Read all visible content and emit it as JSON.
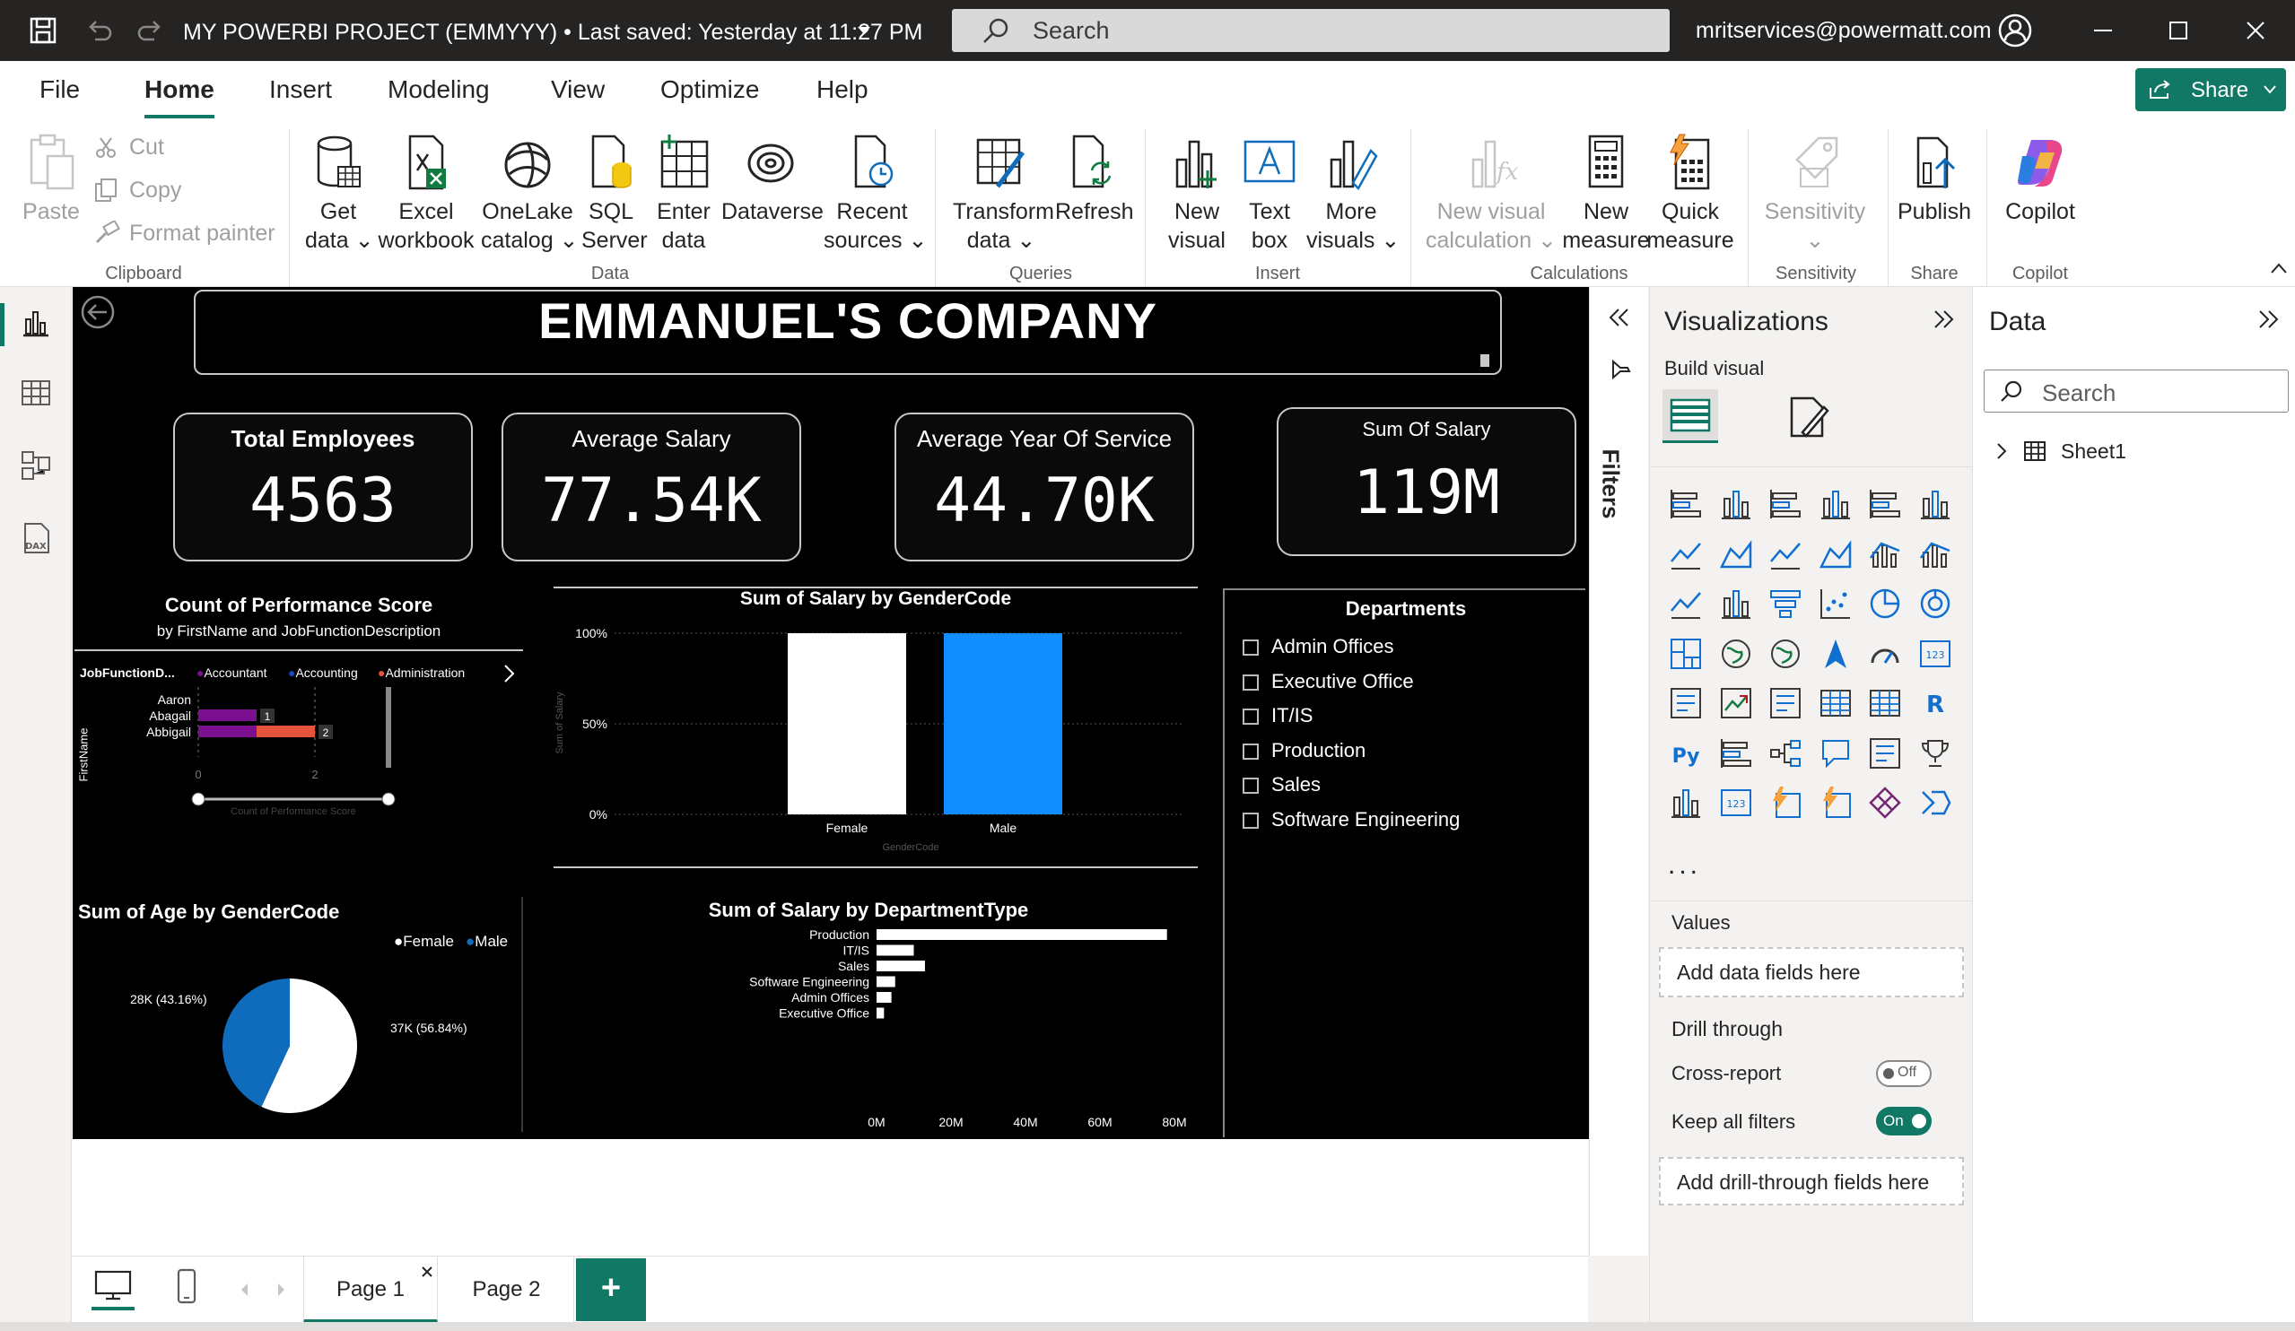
{
  "titlebar": {
    "document_title": "MY POWERBI PROJECT (EMMYYY) • Last saved: Yesterday at 11:27 PM",
    "search_placeholder": "Search",
    "account": "mritservices@powermatt.com"
  },
  "menu": {
    "items": [
      "File",
      "Home",
      "Insert",
      "Modeling",
      "View",
      "Optimize",
      "Help"
    ],
    "active": "Home",
    "share_label": "Share"
  },
  "ribbon": {
    "clipboard": {
      "paste": "Paste",
      "cut": "Cut",
      "copy": "Copy",
      "format_painter": "Format painter",
      "group": "Clipboard"
    },
    "data": {
      "get_data": [
        "Get",
        "data ⌄"
      ],
      "excel": [
        "Excel",
        "workbook"
      ],
      "onelake": [
        "OneLake",
        "catalog ⌄"
      ],
      "sql": [
        "SQL",
        "Server"
      ],
      "enter": [
        "Enter",
        "data"
      ],
      "dataverse": [
        "Dataverse",
        ""
      ],
      "recent": [
        "Recent",
        "sources ⌄"
      ],
      "group": "Data"
    },
    "queries": {
      "transform": [
        "Transform",
        "data ⌄"
      ],
      "refresh": [
        "Refresh",
        ""
      ],
      "group": "Queries"
    },
    "insert": {
      "new_visual": [
        "New",
        "visual"
      ],
      "text_box": [
        "Text",
        "box"
      ],
      "more_visuals": [
        "More",
        "visuals ⌄"
      ],
      "group": "Insert"
    },
    "calculations": {
      "new_visual_calc": [
        "New visual",
        "calculation ⌄"
      ],
      "new_measure": [
        "New",
        "measure"
      ],
      "quick_measure": [
        "Quick",
        "measure"
      ],
      "group": "Calculations"
    },
    "sensitivity": {
      "label": [
        "Sensitivity",
        "⌄"
      ],
      "group": "Sensitivity"
    },
    "share": {
      "publish": [
        "Publish",
        ""
      ],
      "group": "Share"
    },
    "copilot": {
      "label": [
        "Copilot",
        ""
      ],
      "group": "Copilot"
    }
  },
  "report": {
    "title": "EMMANUEL'S COMPANY",
    "kpis": [
      {
        "label": "Total Employees",
        "value": "4563"
      },
      {
        "label": "Average Salary",
        "value": "77.54K"
      },
      {
        "label": "Average Year Of Service",
        "value": "44.70K"
      },
      {
        "label": "Sum Of Salary",
        "value": "119M"
      }
    ],
    "perf_chart": {
      "title": "Count of Performance Score",
      "subtitle": "by FirstName and JobFunctionDescription",
      "legend_title": "JobFunctionD...",
      "legend_items": [
        {
          "name": "Accountant",
          "color": "#7a0f8f"
        },
        {
          "name": "Accounting",
          "color": "#1a46c4"
        },
        {
          "name": "Administration",
          "color": "#e5533c"
        }
      ],
      "y_axis_label": "FirstName",
      "x_axis_label": "Count of Performance Score",
      "names": [
        "Aaron",
        "Abagail",
        "Abbigail"
      ],
      "labels": [
        "",
        "1",
        "2"
      ],
      "x_ticks": [
        "0",
        "2"
      ]
    },
    "departments_slicer": {
      "title": "Departments",
      "items": [
        "Admin Offices",
        "Executive Office",
        "IT/IS",
        "Production",
        "Sales",
        "Software Engineering"
      ]
    },
    "age_pie": {
      "title": "Sum of Age by GenderCode",
      "legend": [
        "Female",
        "Male"
      ],
      "label_female": "37K (56.84%)",
      "label_male": "28K (43.16%)"
    },
    "dept_bar": {
      "title": "Sum of Salary by DepartmentType",
      "x_ticks": [
        "0M",
        "20M",
        "40M",
        "60M",
        "80M"
      ]
    }
  },
  "chart_data": [
    {
      "type": "bar",
      "title": "Sum of Salary by GenderCode",
      "categories": [
        "Female",
        "Male"
      ],
      "values": [
        100,
        100
      ],
      "colors": [
        "#ffffff",
        "#118dff"
      ],
      "xlabel": "GenderCode",
      "ylabel": "Sum of Salary",
      "y_ticks": [
        "0%",
        "50%",
        "100%"
      ],
      "ylim": [
        0,
        100
      ]
    },
    {
      "type": "bar",
      "title": "Count of Performance Score",
      "categories": [
        "Aaron",
        "Abagail",
        "Abbigail"
      ],
      "series": [
        {
          "name": "Accountant",
          "values": [
            0,
            1,
            1
          ]
        },
        {
          "name": "Administration",
          "values": [
            0,
            0,
            1
          ]
        }
      ],
      "xlim": [
        0,
        2
      ]
    },
    {
      "type": "pie",
      "title": "Sum of Age by GenderCode",
      "categories": [
        "Female",
        "Male"
      ],
      "values": [
        37000,
        28000
      ],
      "colors": [
        "#ffffff",
        "#0f6cbd"
      ]
    },
    {
      "type": "bar",
      "orientation": "horizontal",
      "title": "Sum of Salary by DepartmentType",
      "categories": [
        "Production",
        "IT/IS",
        "Sales",
        "Software Engineering",
        "Admin Offices",
        "Executive Office"
      ],
      "values": [
        78,
        10,
        13,
        5,
        4,
        2
      ],
      "unit": "M",
      "xlim": [
        0,
        80
      ]
    }
  ],
  "filters_label": "Filters",
  "viz_pane": {
    "title": "Visualizations",
    "build_visual": "Build visual",
    "more": "...",
    "values_label": "Values",
    "values_placeholder": "Add data fields here",
    "drill_through": "Drill through",
    "cross_report": "Cross-report",
    "cross_report_state": "Off",
    "keep_all_filters": "Keep all filters",
    "keep_all_filters_state": "On",
    "drill_placeholder": "Add drill-through fields here"
  },
  "data_pane": {
    "title": "Data",
    "search_placeholder": "Search",
    "tables": [
      "Sheet1"
    ]
  },
  "pages": {
    "tabs": [
      "Page 1",
      "Page 2"
    ],
    "active": "Page 1",
    "add_label": "+"
  }
}
